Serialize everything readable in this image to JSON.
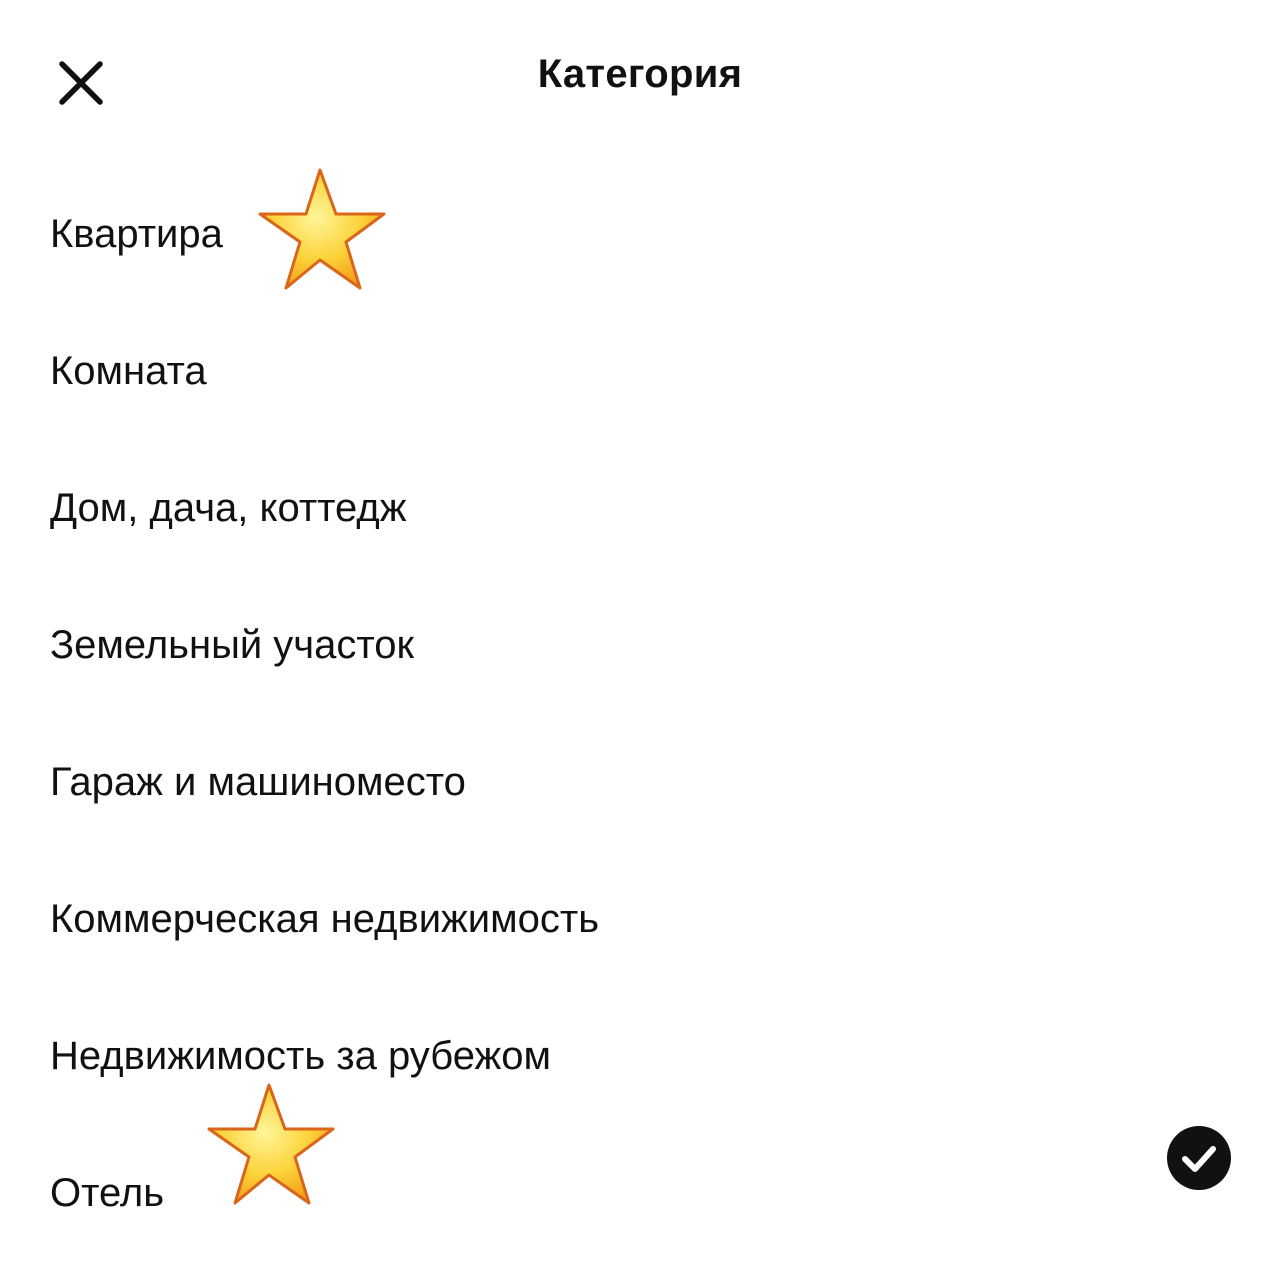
{
  "header": {
    "title": "Категория",
    "close_icon": "close-icon"
  },
  "categories": [
    {
      "label": "Квартира",
      "marked": true,
      "selected": false
    },
    {
      "label": "Комната",
      "marked": false,
      "selected": false
    },
    {
      "label": "Дом, дача, коттедж",
      "marked": false,
      "selected": false
    },
    {
      "label": "Земельный участок",
      "marked": false,
      "selected": false
    },
    {
      "label": "Гараж и машиноместо",
      "marked": false,
      "selected": false
    },
    {
      "label": "Коммерческая недвижимость",
      "marked": false,
      "selected": false
    },
    {
      "label": "Недвижимость за рубежом",
      "marked": false,
      "selected": false
    },
    {
      "label": "Отель",
      "marked": true,
      "selected": true
    }
  ],
  "icons": {
    "marker": "star-icon",
    "selected": "check-circle-icon"
  },
  "colors": {
    "text": "#111111",
    "background": "#ffffff",
    "check_fill": "#111111",
    "star_light": "#fff27a",
    "star_dark": "#f2a31b",
    "star_edge": "#d9661a"
  }
}
